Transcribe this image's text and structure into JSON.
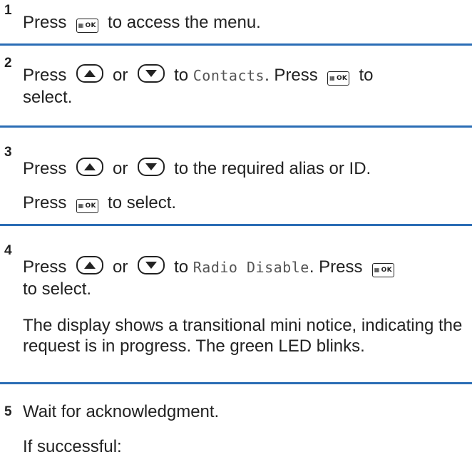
{
  "icons": {
    "ok_button": {
      "name": "menu-ok-button-icon",
      "text": "OK"
    },
    "up_button": {
      "name": "up-arrow-button-icon"
    },
    "down_button": {
      "name": "down-arrow-button-icon"
    }
  },
  "colors": {
    "divider": "#2a6db5",
    "text": "#222222"
  },
  "steps": [
    {
      "number": "1",
      "parts": [
        "Press",
        "to access the menu."
      ]
    },
    {
      "number": "2",
      "parts": [
        "Press",
        "or",
        "to",
        "Contacts",
        ". Press",
        "to",
        "select."
      ]
    },
    {
      "number": "3",
      "parts": [
        "Press",
        "or",
        "to the required alias or ID.",
        "Press",
        "to select."
      ]
    },
    {
      "number": "4",
      "parts": [
        "Press",
        "or",
        "to",
        "Radio Disable",
        ". Press",
        "to select."
      ],
      "note": "The display shows a transitional mini notice, indicating the request is in progress. The green LED blinks."
    },
    {
      "number": "5",
      "parts": [
        "Wait for acknowledgment.",
        "If successful:"
      ]
    }
  ]
}
